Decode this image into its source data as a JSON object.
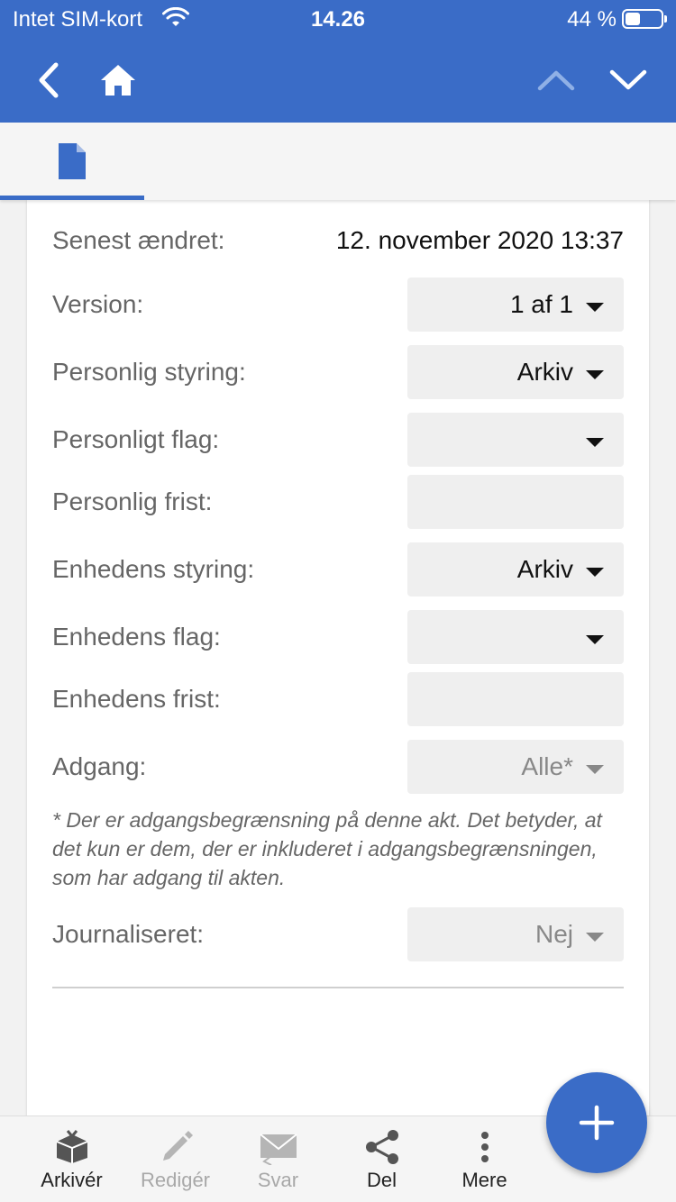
{
  "status_bar": {
    "carrier": "Intet SIM-kort",
    "time": "14.26",
    "battery_percent": "44 %"
  },
  "colors": {
    "accent": "#3a6cc7",
    "label": "#666666",
    "field_bg": "#efefef"
  },
  "nav": {
    "back_icon": "chevron-left-icon",
    "home_icon": "home-icon",
    "up_icon": "chevron-up-icon",
    "down_icon": "chevron-down-icon"
  },
  "tabs": [
    {
      "icon": "document-icon",
      "active": true
    }
  ],
  "details": {
    "last_modified_label": "Senest ændret:",
    "last_modified_value": "12. november 2020 13:37",
    "version_label": "Version:",
    "version_value": "1 af 1",
    "personal_control_label": "Personlig styring:",
    "personal_control_value": "Arkiv",
    "personal_flag_label": "Personligt flag:",
    "personal_flag_value": "",
    "personal_deadline_label": "Personlig frist:",
    "personal_deadline_value": "",
    "unit_control_label": "Enhedens styring:",
    "unit_control_value": "Arkiv",
    "unit_flag_label": "Enhedens flag:",
    "unit_flag_value": "",
    "unit_deadline_label": "Enhedens frist:",
    "unit_deadline_value": "",
    "access_label": "Adgang:",
    "access_value": "Alle*",
    "access_note": "* Der er adgangsbegrænsning på denne akt. Det betyder, at det kun er dem, der er inkluderet i adgangsbegrænsningen, som har adgang til akten.",
    "journalized_label": "Journaliseret:",
    "journalized_value": "Nej"
  },
  "toolbar": {
    "archive_label": "Arkivér",
    "edit_label": "Redigér",
    "reply_label": "Svar",
    "share_label": "Del",
    "more_label": "Mere"
  },
  "fab": {
    "icon": "plus-icon"
  }
}
